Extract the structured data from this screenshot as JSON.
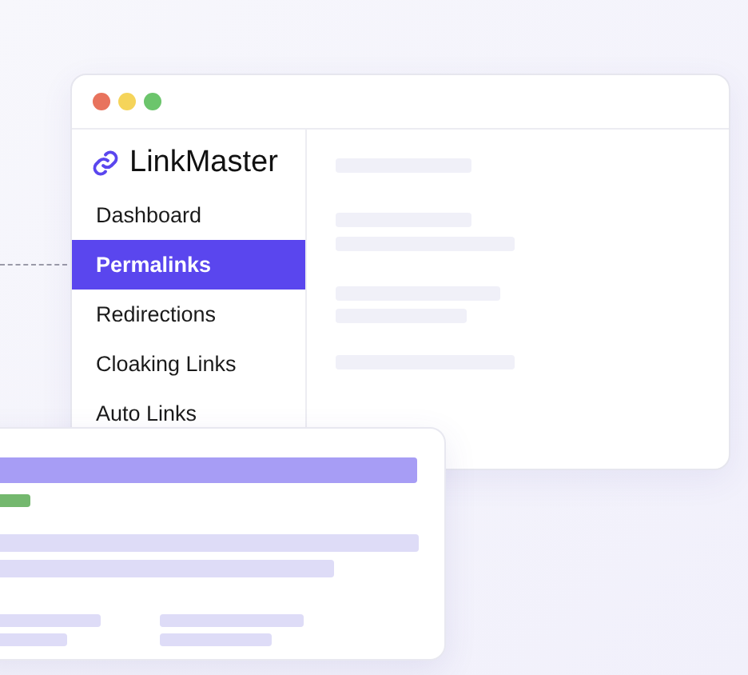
{
  "app": {
    "name": "LinkMaster"
  },
  "sidebar": {
    "items": [
      {
        "label": "Dashboard",
        "selected": false
      },
      {
        "label": "Permalinks",
        "selected": true
      },
      {
        "label": "Redirections",
        "selected": false
      },
      {
        "label": "Cloaking Links",
        "selected": false
      },
      {
        "label": "Auto Links",
        "selected": false
      }
    ]
  }
}
